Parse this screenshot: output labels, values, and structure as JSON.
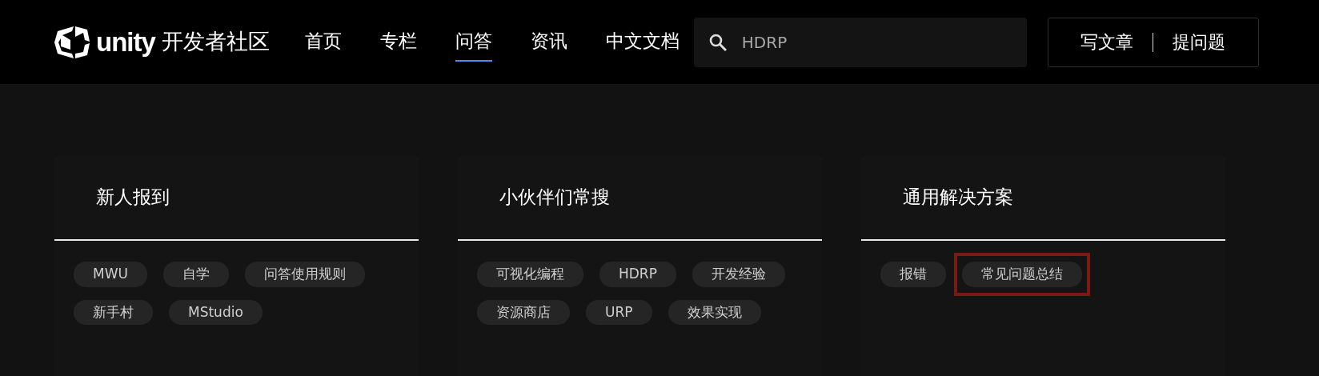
{
  "header": {
    "logo_text": "unity",
    "site_name": "开发者社区",
    "nav": [
      {
        "label": "首页",
        "selected": false
      },
      {
        "label": "专栏",
        "selected": false
      },
      {
        "label": "问答",
        "selected": true
      },
      {
        "label": "资讯",
        "selected": false
      },
      {
        "label": "中文文档",
        "selected": false
      }
    ],
    "search": {
      "placeholder": "HDRP"
    },
    "actions": [
      "写文章",
      "提问题"
    ]
  },
  "cards": [
    {
      "title": "新人报到",
      "tags": [
        {
          "label": "MWU",
          "highlighted": false
        },
        {
          "label": "自学",
          "highlighted": false
        },
        {
          "label": "问答使用规则",
          "highlighted": false
        },
        {
          "label": "新手村",
          "highlighted": false
        },
        {
          "label": "MStudio",
          "highlighted": false
        }
      ]
    },
    {
      "title": "小伙伴们常搜",
      "tags": [
        {
          "label": "可视化编程",
          "highlighted": false
        },
        {
          "label": "HDRP",
          "highlighted": false
        },
        {
          "label": "开发经验",
          "highlighted": false
        },
        {
          "label": "资源商店",
          "highlighted": false
        },
        {
          "label": "URP",
          "highlighted": false
        },
        {
          "label": "效果实现",
          "highlighted": false
        }
      ]
    },
    {
      "title": "通用解决方案",
      "tags": [
        {
          "label": "报错",
          "highlighted": false
        },
        {
          "label": "常见问题总结",
          "highlighted": true
        }
      ]
    }
  ]
}
